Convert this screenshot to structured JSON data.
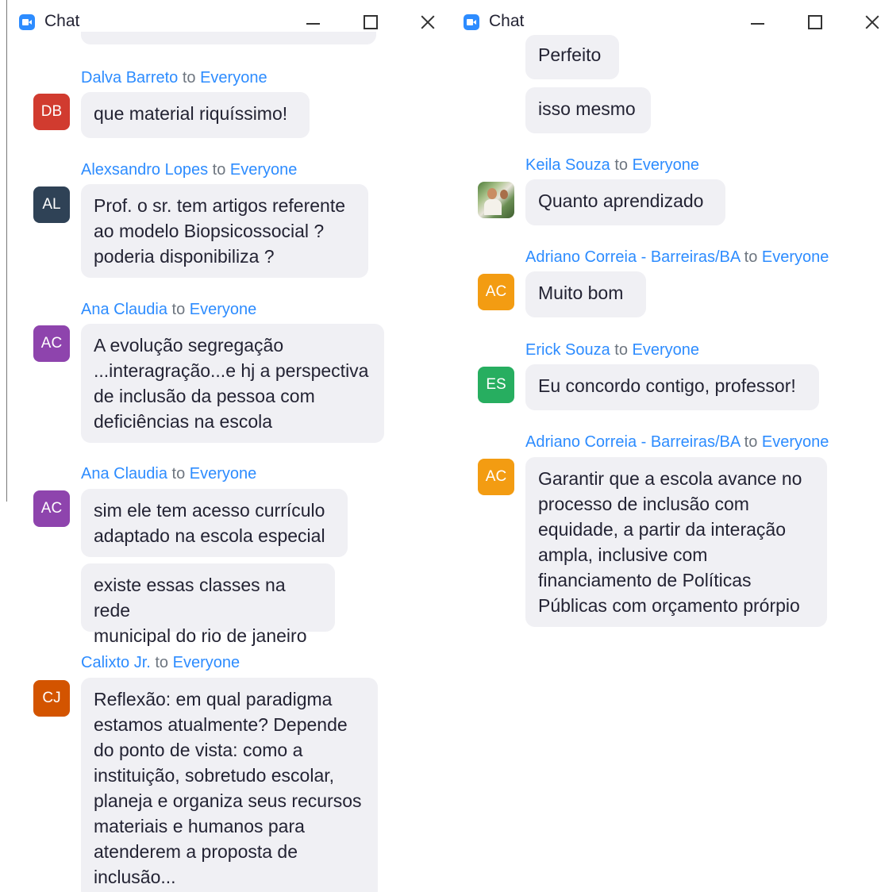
{
  "windows": [
    {
      "title": "Chat",
      "messages": [
        {
          "sender": "Dalva Barreto",
          "to_word": "to",
          "recipient": "Everyone",
          "initials": "DB",
          "color": "#d13b2f",
          "bubbles": [
            "que material riquíssimo!"
          ]
        },
        {
          "sender": "Alexsandro Lopes",
          "to_word": "to",
          "recipient": "Everyone",
          "initials": "AL",
          "color": "#2f4256",
          "bubbles": [
            "Prof. o sr. tem artigos referente\nao modelo Biopsicossocial ?\npoderia disponibiliza ?"
          ]
        },
        {
          "sender": "Ana Claudia",
          "to_word": "to",
          "recipient": "Everyone",
          "initials": "AC",
          "color": "#8e44ad",
          "bubbles": [
            "A evolução segregação\n...interagração...e hj a perspectiva\nde inclusão da pessoa com\ndeficiências na escola"
          ]
        },
        {
          "sender": "Ana Claudia",
          "to_word": "to",
          "recipient": "Everyone",
          "initials": "AC",
          "color": "#8e44ad",
          "bubbles": [
            "sim ele tem acesso currículo\nadaptado na escola especial",
            "existe essas classes na rede\nmunicipal do rio de janeiro"
          ]
        },
        {
          "sender": "Calixto Jr.",
          "to_word": "to",
          "recipient": "Everyone",
          "initials": "CJ",
          "color": "#d35400",
          "bubbles": [
            "Reflexão: em qual paradigma\nestamos atualmente?  Depende\ndo ponto de vista: como a\ninstituição, sobretudo escolar,\nplaneja e organiza seus recursos\nmateriais e humanos para\natenderem a proposta de\ninclusão..."
          ]
        }
      ]
    },
    {
      "title": "Chat",
      "orphan_bubbles": [
        "Perfeito",
        "isso mesmo"
      ],
      "messages": [
        {
          "sender": "Keila Souza",
          "to_word": "to",
          "recipient": "Everyone",
          "initials": "",
          "color": "",
          "bubbles": [
            "Quanto aprendizado"
          ]
        },
        {
          "sender": "Adriano Correia - Barreiras/BA",
          "to_word": "to",
          "recipient": "Everyone",
          "initials": "AC",
          "color": "#f39c12",
          "bubbles": [
            "Muito bom"
          ]
        },
        {
          "sender": "Erick Souza",
          "to_word": "to",
          "recipient": "Everyone",
          "initials": "ES",
          "color": "#27ae60",
          "bubbles": [
            "Eu concordo contigo, professor!"
          ]
        },
        {
          "sender": "Adriano Correia - Barreiras/BA",
          "to_word": "to",
          "recipient": "Everyone",
          "initials": "AC",
          "color": "#f39c12",
          "bubbles": [
            "Garantir que a escola avance no\nprocesso de inclusão com\nequidade, a partir da interação\nampla, inclusive com\nfinanciamento de Políticas\nPúblicas com orçamento prórpio"
          ]
        }
      ]
    }
  ]
}
